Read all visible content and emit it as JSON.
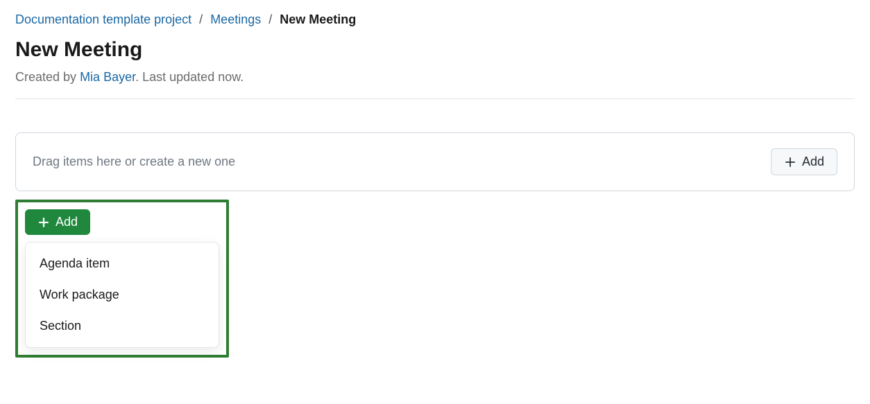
{
  "breadcrumb": {
    "items": [
      {
        "label": "Documentation template project"
      },
      {
        "label": "Meetings"
      }
    ],
    "current": "New Meeting"
  },
  "page": {
    "title": "New Meeting",
    "created_by_prefix": "Created by ",
    "author": "Mia Bayer",
    "updated_suffix": ". Last updated now."
  },
  "dropzone": {
    "placeholder": "Drag items here or create a new one",
    "add_label": "Add"
  },
  "add_menu": {
    "button_label": "Add",
    "items": [
      {
        "label": "Agenda item"
      },
      {
        "label": "Work package"
      },
      {
        "label": "Section"
      }
    ]
  }
}
